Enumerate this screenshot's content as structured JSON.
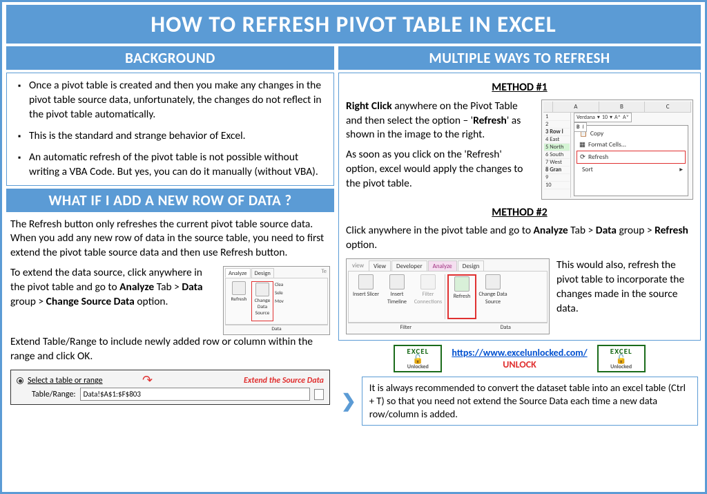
{
  "title": "HOW TO REFRESH PIVOT TABLE IN EXCEL",
  "left": {
    "background_header": "BACKGROUND",
    "bullets": [
      "Once a pivot table is created and then you make any changes in the pivot table source data, unfortunately, the changes do not reflect in the pivot table automatically.",
      "This is the standard and strange behavior of Excel.",
      "An automatic refresh of the pivot table is not possible without writing a VBA Code. But yes, you can do it manually (without VBA)."
    ],
    "newrow_header": "WHAT IF I ADD A NEW ROW OF DATA ?",
    "newrow_p1": "The Refresh button only refreshes the current pivot table source data. When you add any new row of data in the source table, you need to first extend the pivot table source data and then use Refresh button.",
    "newrow_p2_pre": "To extend the data source, click anywhere in the pivot table and go to ",
    "newrow_p2_b1": "Analyze",
    "newrow_p2_mid1": " Tab > ",
    "newrow_p2_b2": "Data",
    "newrow_p2_mid2": " group > ",
    "newrow_p2_b3": "Change Source Data",
    "newrow_p2_end": " option.",
    "newrow_p3": "Extend Table/Range to include newly added row or column within the range and click OK.",
    "range_radio": "Select a table or range",
    "range_label": "Table/Range:",
    "range_value": "Data!$A$1:$F$803",
    "extend_label": "Extend the Source Data",
    "analyze_tabs": [
      "Analyze",
      "Design"
    ],
    "analyze_right": "Te",
    "analyze_btn1": "Refresh",
    "analyze_btn2": "Change Data Source",
    "analyze_side": [
      "Clea",
      "Sele",
      "Mov"
    ],
    "analyze_group": "Data"
  },
  "right": {
    "ways_header": "MULTIPLE WAYS TO REFRESH",
    "method1_label": "METHOD #1",
    "m1_p1_pre": "Right Click",
    "m1_p1_rest": " anywhere on the Pivot Table and then select the option – '",
    "m1_p1_b": "Refresh",
    "m1_p1_end": "' as shown in the image to the right.",
    "m1_p2": "As soon as you click on the 'Refresh' option, excel would apply the changes to the pivot table.",
    "m1_cols": [
      "A",
      "B",
      "C"
    ],
    "m1_rows": [
      "1",
      "2",
      "3 Row l",
      "4 East",
      "5 North",
      "6 South",
      "7 West",
      "8 Gran",
      "9",
      "10"
    ],
    "m1_menu": [
      "Copy",
      "Format Cells...",
      "Refresh",
      "Sort"
    ],
    "m1_font": "Verdana",
    "m1_size": "10",
    "method2_label": "METHOD #2",
    "m2_p1_pre": "Click anywhere in the pivot table and go to ",
    "m2_p1_b1": "Analyze",
    "m2_p1_mid1": " Tab > ",
    "m2_p1_b2": "Data",
    "m2_p1_mid2": " group > ",
    "m2_p1_b3": "Refresh",
    "m2_p1_end": " option.",
    "m2_side": "This would also, refresh the pivot table to incorporate the changes made in the source data.",
    "rib_tabs": [
      "view",
      "View",
      "Developer",
      "Analyze",
      "Design"
    ],
    "rib_btns": [
      "Insert Slicer",
      "Insert Timeline",
      "Filter Connections",
      "Refresh",
      "Change Data Source"
    ],
    "rib_group": "Filter",
    "rib_group2": "Data",
    "footer_url": "https://www.excelunlocked.com/",
    "footer_unlock": "UNLOCK",
    "logo_top": "EXCEL",
    "logo_bot": "Unlocked",
    "tip": "It is always recommended to convert the dataset table into an excel table (Ctrl + T) so that you need not extend the Source Data each time a new data row/column is added."
  }
}
